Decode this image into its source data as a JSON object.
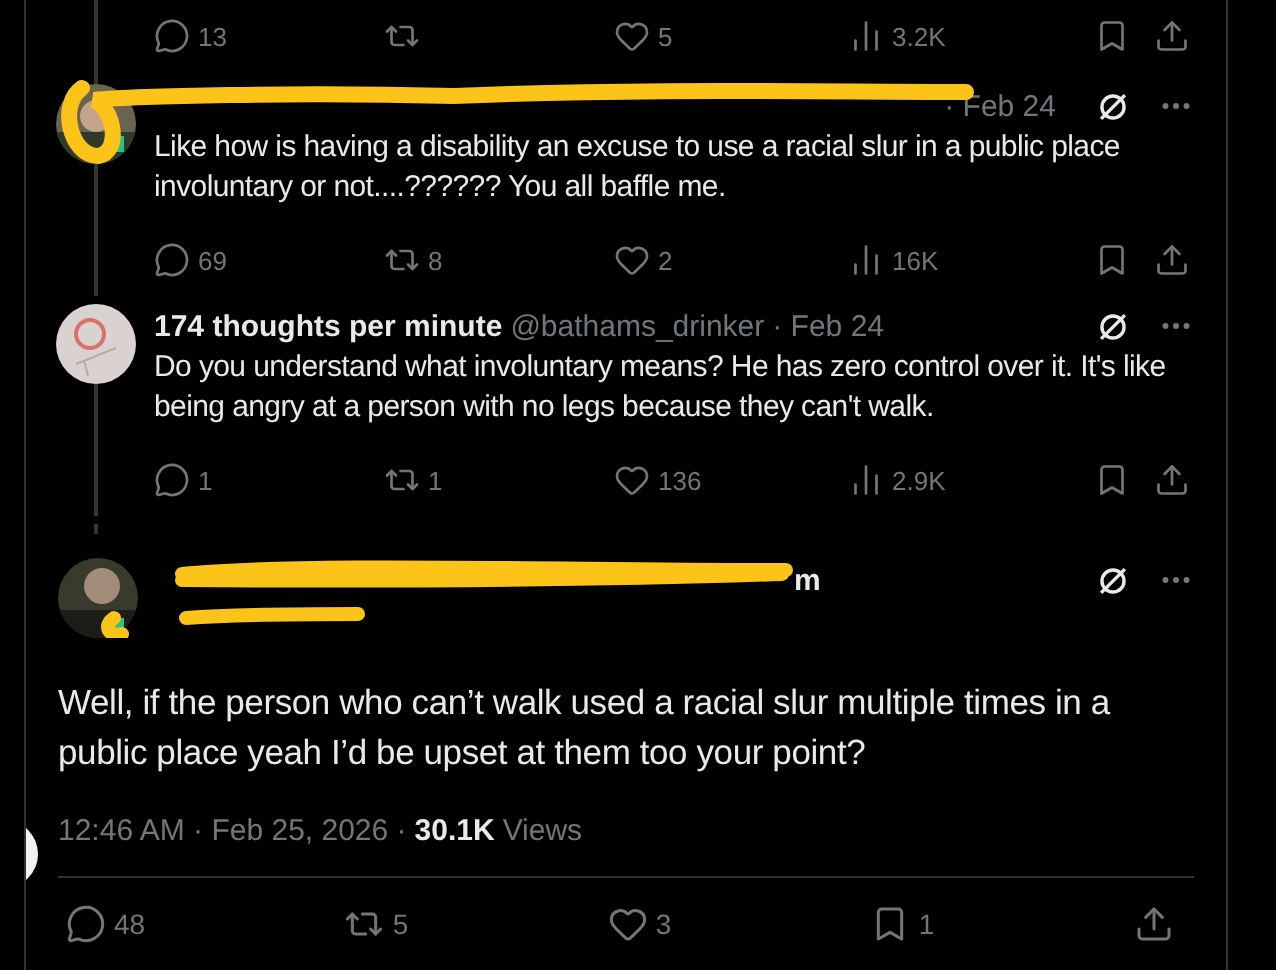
{
  "top_actions": [
    {
      "kind": "reply",
      "count": "13"
    },
    {
      "kind": "repost"
    },
    {
      "kind": "like",
      "count": "5"
    },
    {
      "kind": "views",
      "count": "3.2K"
    },
    {
      "kind": "bookmark"
    },
    {
      "kind": "share"
    }
  ],
  "replies": [
    {
      "redacted": true,
      "date": "· Feb 24",
      "text": "Like how is having a disability an excuse to use a racial slur in a public place involuntary or not....?????? You all baffle me.",
      "actions": [
        {
          "kind": "reply",
          "count": "69"
        },
        {
          "kind": "repost",
          "count": "8"
        },
        {
          "kind": "like",
          "count": "2"
        },
        {
          "kind": "views",
          "count": "16K"
        },
        {
          "kind": "bookmark"
        },
        {
          "kind": "share"
        }
      ]
    },
    {
      "redacted": false,
      "name": "174 thoughts per minute",
      "handle": "@bathams_drinker",
      "date": "· Feb 24",
      "text": "Do you understand what involuntary means? He has zero control over it. It's like being angry at a person with no legs because they can't walk.",
      "actions": [
        {
          "kind": "reply",
          "count": "1"
        },
        {
          "kind": "repost",
          "count": "1"
        },
        {
          "kind": "like",
          "count": "136"
        },
        {
          "kind": "views",
          "count": "2.9K"
        },
        {
          "kind": "bookmark"
        },
        {
          "kind": "share"
        }
      ]
    }
  ],
  "main_tweet": {
    "redacted": true,
    "name": "m",
    "text": "Well, if the person who can’t walk used a racial slur multiple times in a public place yeah I’d be upset at them too your point?",
    "timestamp": "12:46 AM · Feb 25, 2026 ·",
    "views_count": "30.1K",
    "views_label": "Views",
    "actions": [
      {
        "kind": "reply",
        "count": "48"
      },
      {
        "kind": "repost",
        "count": "5"
      },
      {
        "kind": "like",
        "count": "3"
      },
      {
        "kind": "bookmark",
        "count": "1"
      },
      {
        "kind": "share"
      }
    ]
  }
}
